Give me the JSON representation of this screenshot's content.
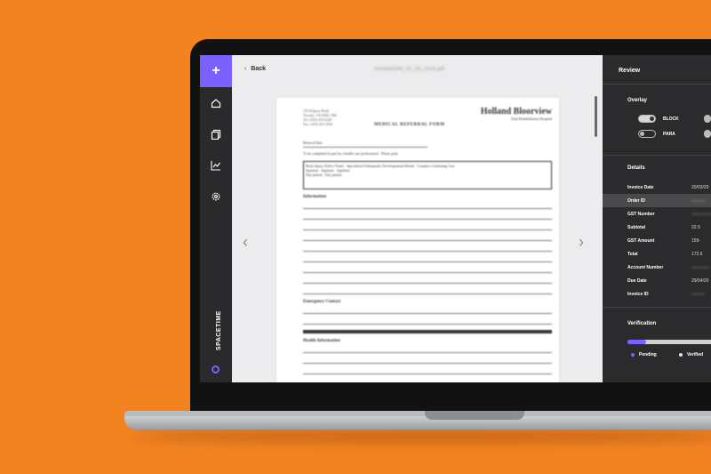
{
  "colors": {
    "background": "#f38321",
    "accent": "#7b61ff",
    "panel": "#2b2b2d",
    "sidebar": "#2a2a2c"
  },
  "sidebar": {
    "add_icon": "+",
    "items": [
      {
        "icon": "home-icon"
      },
      {
        "icon": "copy-icon"
      },
      {
        "icon": "chart-icon"
      },
      {
        "icon": "gear-icon"
      }
    ],
    "brand": "SPACETIME"
  },
  "viewer": {
    "back_label": "Back",
    "filename": "Invoice0046_01_05_2016.pdf",
    "prev_icon": "‹",
    "next_icon": "›",
    "document": {
      "form_title": "MEDICAL REFERRAL FORM",
      "logo": "Holland Bloorview",
      "logo_sub": "Kids Rehabilitation Hospital",
      "referral_line": "Referral Date",
      "instructions": "To be completed in part by a health care professional - Please print",
      "options": [
        "Brain Injury (Select Team)",
        "Specialized Orthopaedic Developmental Rehab",
        "Complex Continuing Care",
        "Inpatient",
        "Inpatient",
        "Inpatient",
        "Day patient",
        "Day patient"
      ],
      "sect_info": "Information",
      "sect_emergency": "Emergency Contact",
      "sect_health": "Health Information"
    }
  },
  "review": {
    "title": "Review",
    "overlay": {
      "label": "Overlay",
      "toggles": [
        {
          "label": "BLOCK",
          "on": true
        },
        {
          "label": "PARA",
          "on": false
        }
      ]
    },
    "details": {
      "label": "Details",
      "rows": [
        {
          "key": "Invoice Date",
          "value": "20/03/20"
        },
        {
          "key": "Order ID",
          "value": "———"
        },
        {
          "key": "GST Number",
          "value": "—————"
        },
        {
          "key": "Subtotal",
          "value": "22.5"
        },
        {
          "key": "GST Amount",
          "value": "159-"
        },
        {
          "key": "Total",
          "value": "172.6"
        },
        {
          "key": "Account Number",
          "value": "————"
        },
        {
          "key": "Due Date",
          "value": "29/04/20"
        },
        {
          "key": "Invoice ID",
          "value": "———"
        }
      ]
    },
    "verification": {
      "label": "Verification",
      "progress": 0.18,
      "legend": [
        {
          "label": "Pending",
          "color": "#7b61ff"
        },
        {
          "label": "Verified",
          "color": "#e0e0e0"
        }
      ]
    }
  }
}
